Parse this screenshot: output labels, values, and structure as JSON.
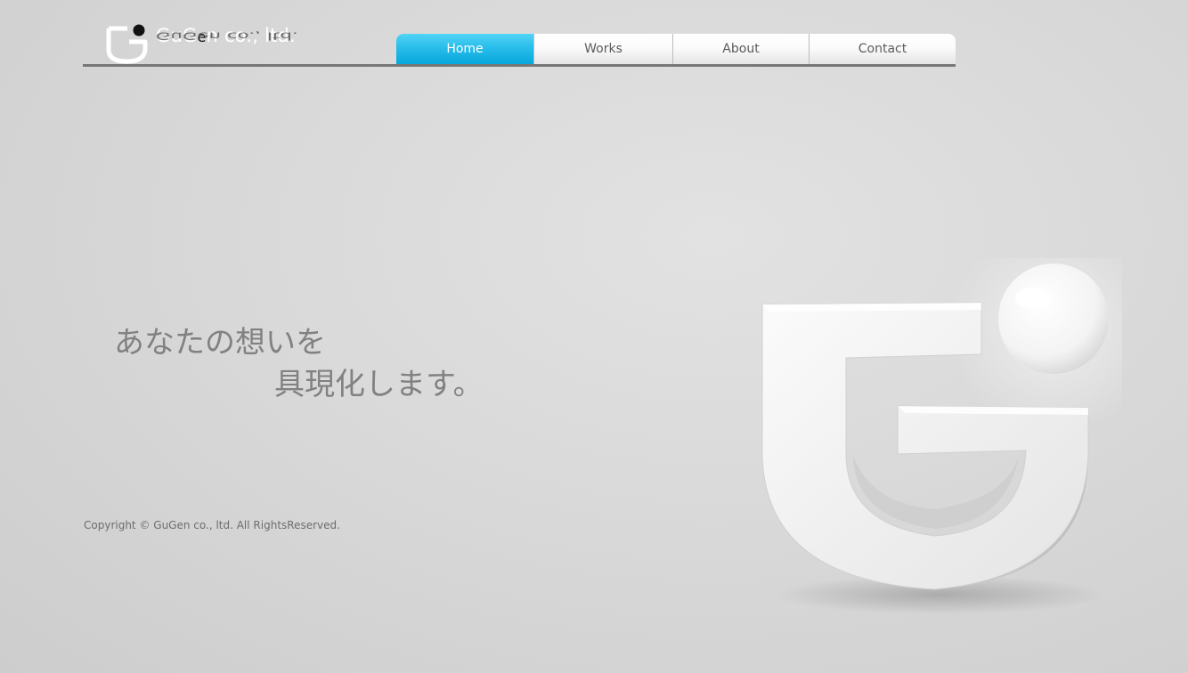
{
  "logo": {
    "text_before": "GuG",
    "text_e": "e",
    "text_after": "n co., ltd.",
    "reflection": "GuGen co., ltd."
  },
  "nav": {
    "items": [
      {
        "label": "Home",
        "active": true
      },
      {
        "label": "Works",
        "active": false
      },
      {
        "label": "About",
        "active": false
      },
      {
        "label": "Contact",
        "active": false
      }
    ]
  },
  "tagline": {
    "line1": "あなたの想いを",
    "line2": "具現化します。"
  },
  "footer": {
    "copyright": "Copyright © GuGen co., ltd. All RightsReserved."
  },
  "colors": {
    "accent": "#1fb8ea",
    "background": "#d9d9d9",
    "text": "#818181"
  },
  "icons": {
    "logo_mark": "gugen-logo-icon",
    "hero": "gugen-3d-logo-icon"
  }
}
